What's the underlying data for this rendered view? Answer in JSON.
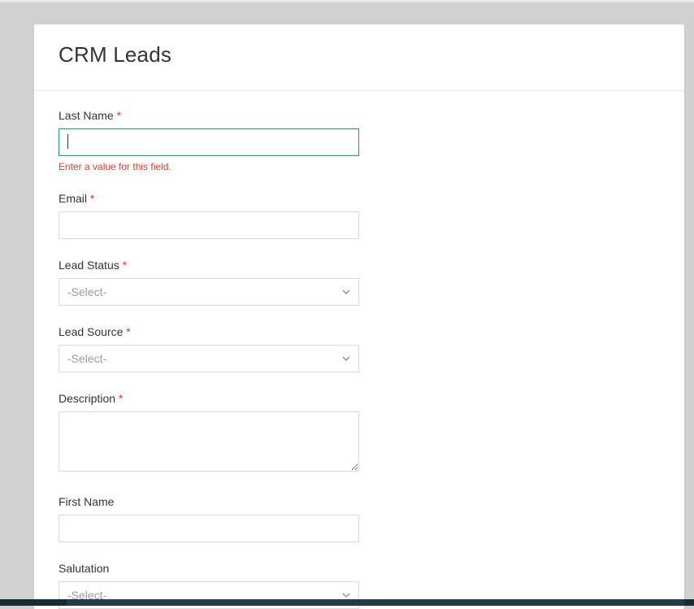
{
  "header": {
    "title": "CRM Leads"
  },
  "form": {
    "last_name": {
      "label": "Last Name",
      "required": true,
      "value": "",
      "error": "Enter a value for this field."
    },
    "email": {
      "label": "Email",
      "required": true,
      "value": ""
    },
    "lead_status": {
      "label": "Lead Status",
      "required": true,
      "placeholder": "-Select-"
    },
    "lead_source": {
      "label": "Lead Source",
      "required": true,
      "placeholder": "-Select-"
    },
    "description": {
      "label": "Description",
      "required": true,
      "value": ""
    },
    "first_name": {
      "label": "First Name",
      "required": false,
      "value": ""
    },
    "salutation": {
      "label": "Salutation",
      "required": false,
      "placeholder": "-Select-"
    }
  },
  "required_marker": "*"
}
